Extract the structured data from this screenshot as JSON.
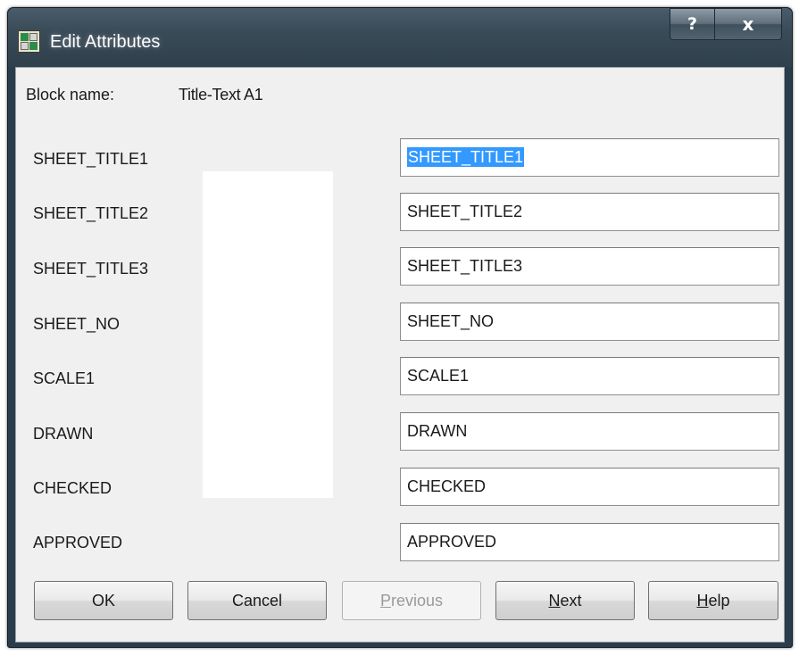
{
  "window": {
    "title": "Edit Attributes",
    "help_glyph": "?",
    "close_glyph": "x"
  },
  "block": {
    "label": "Block name:",
    "value": "Title-Text A1"
  },
  "attributes": [
    {
      "tag": "SHEET_TITLE1",
      "value": "SHEET_TITLE1",
      "selected": true
    },
    {
      "tag": "SHEET_TITLE2",
      "value": "SHEET_TITLE2"
    },
    {
      "tag": "SHEET_TITLE3",
      "value": "SHEET_TITLE3"
    },
    {
      "tag": "SHEET_NO",
      "value": "SHEET_NO"
    },
    {
      "tag": "SCALE1",
      "value": "SCALE1"
    },
    {
      "tag": "DRAWN",
      "value": "DRAWN"
    },
    {
      "tag": "CHECKED",
      "value": "CHECKED"
    },
    {
      "tag": "APPROVED",
      "value": "APPROVED"
    }
  ],
  "buttons": {
    "ok": "OK",
    "cancel": "Cancel",
    "previous_mnemonic": "P",
    "previous_rest": "revious",
    "next_mnemonic": "N",
    "next_rest": "ext",
    "help_mnemonic": "H",
    "help_rest": "elp"
  },
  "colors": {
    "selection": "#3399ff",
    "titlebar": "#3a4b58",
    "dialog_bg": "#f0f0f0"
  }
}
